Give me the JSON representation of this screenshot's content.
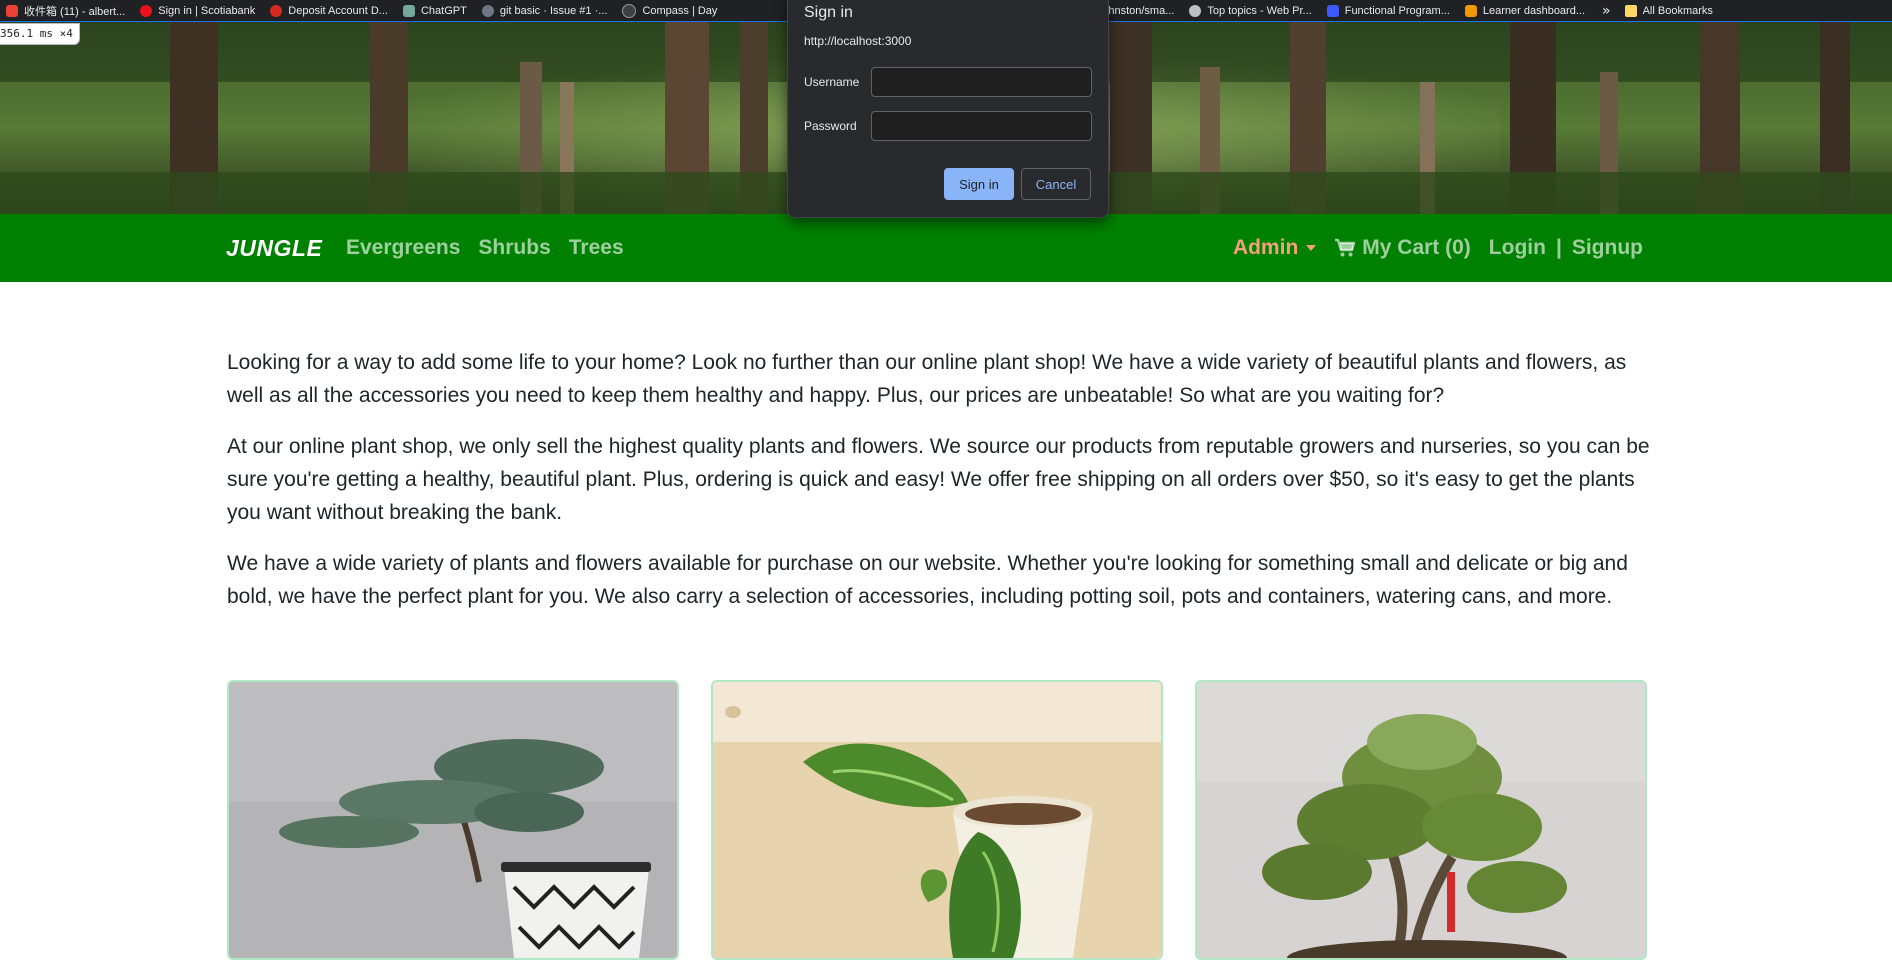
{
  "bookmarks": [
    {
      "label": "收件箱 (11) - albert...",
      "icon": "gmail-icon",
      "color": "#ea4335"
    },
    {
      "label": "Sign in | Scotiabank",
      "icon": "scotiabank-icon",
      "color": "#ec111a"
    },
    {
      "label": "Deposit Account D...",
      "icon": "bank-icon",
      "color": "#d52b1e"
    },
    {
      "label": "ChatGPT",
      "icon": "chatgpt-icon",
      "color": "#74aa9c"
    },
    {
      "label": "git basic · Issue #1 ·...",
      "icon": "github-icon",
      "color": "#6e7681"
    },
    {
      "label": "Compass | Day",
      "icon": "compass-icon",
      "color": "#3c4043"
    },
    {
      "label": "mxtchjohnston/sma...",
      "icon": "github-icon",
      "color": "#6e7681"
    },
    {
      "label": "Top topics - Web Pr...",
      "icon": "forum-icon",
      "color": "#bdc1c6"
    },
    {
      "label": "Functional Program...",
      "icon": "course-icon",
      "color": "#3d5afe"
    },
    {
      "label": "Learner dashboard...",
      "icon": "dashboard-icon",
      "color": "#f29900"
    }
  ],
  "bookmarks_more": "»",
  "all_bookmarks": "All Bookmarks",
  "timing_text": "356.1 ms ×4",
  "nav": {
    "brand": "JUNGLE",
    "links": [
      "Evergreens",
      "Shrubs",
      "Trees"
    ],
    "admin": "Admin",
    "cart": "My Cart (0)",
    "login": "Login",
    "separator": "|",
    "signup": "Signup"
  },
  "paragraphs": [
    "Looking for a way to add some life to your home? Look no further than our online plant shop! We have a wide variety of beautiful plants and flowers, as well as all the accessories you need to keep them healthy and happy. Plus, our prices are unbeatable! So what are you waiting for?",
    "At our online plant shop, we only sell the highest quality plants and flowers. We source our products from reputable growers and nurseries, so you can be sure you're getting a healthy, beautiful plant. Plus, ordering is quick and easy! We offer free shipping on all orders over $50, so it's easy to get the plants you want without breaking the bank.",
    "We have a wide variety of plants and flowers available for purchase on our website. Whether you're looking for something small and delicate or big and bold, we have the perfect plant for you. We also carry a selection of accessories, including potting soil, pots and containers, watering cans, and more."
  ],
  "cards": [
    {
      "image": "juniper-bonsai-image"
    },
    {
      "image": "pothos-plant-image"
    },
    {
      "image": "bonsai-tree-image"
    }
  ],
  "dialog": {
    "title": "Sign in",
    "url": "http://localhost:3000",
    "username_label": "Username",
    "password_label": "Password",
    "username_value": "",
    "password_value": "",
    "sign_in": "Sign in",
    "cancel": "Cancel"
  },
  "colors": {
    "nav_bg": "#008000",
    "admin": "#f4a17b",
    "card_border": "#b3e6c4",
    "dialog_bg": "#292a2d",
    "primary_button": "#8ab4f8"
  }
}
